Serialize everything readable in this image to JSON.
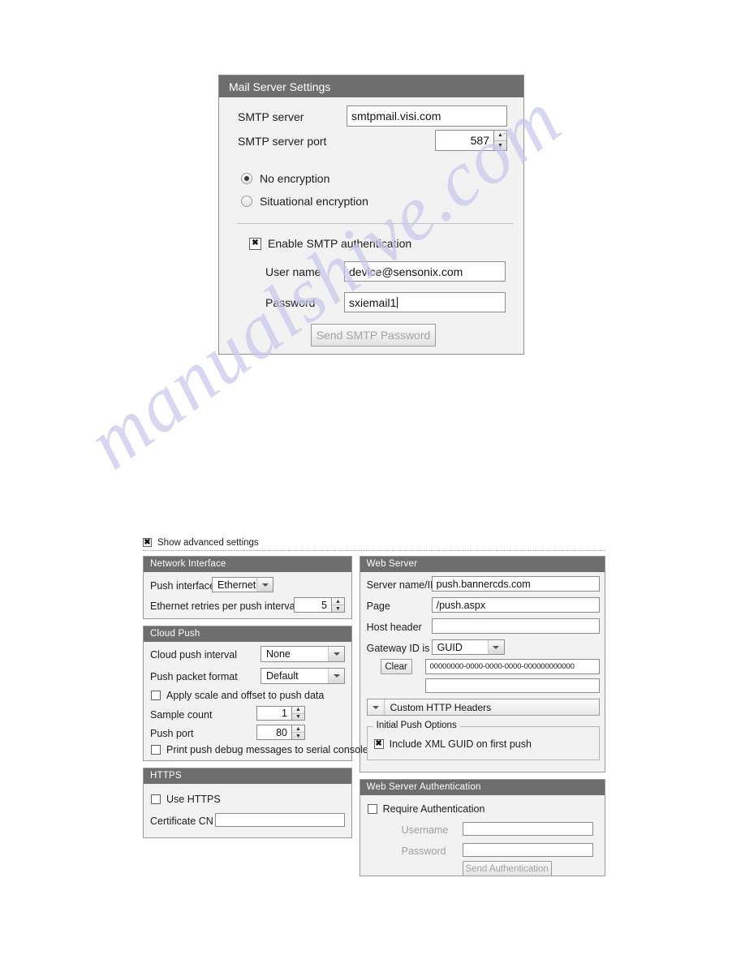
{
  "watermark": {
    "text": "manualshive.com"
  },
  "mail_dialog": {
    "title": "Mail Server Settings",
    "smtp_server_label": "SMTP server",
    "smtp_server_value": "smtpmail.visi.com",
    "smtp_port_label": "SMTP server port",
    "smtp_port_value": "587",
    "encryption_options": [
      {
        "label": "No encryption",
        "selected": true
      },
      {
        "label": "Situational encryption",
        "selected": false
      }
    ],
    "enable_auth_label": "Enable SMTP authentication",
    "enable_auth_checked": true,
    "username_label": "User name",
    "username_value": "device@sensonix.com",
    "password_label": "Password",
    "password_value": "sxiemail1",
    "send_button_label": "Send SMTP Password"
  },
  "advanced": {
    "show_advanced_label": "Show advanced settings",
    "show_advanced_checked": true,
    "network_interface": {
      "title": "Network Interface",
      "push_interface_label": "Push interface",
      "push_interface_value": "Ethernet",
      "retries_label": "Ethernet retries per push interval",
      "retries_value": "5"
    },
    "cloud_push": {
      "title": "Cloud Push",
      "interval_label": "Cloud push interval",
      "interval_value": "None",
      "packet_format_label": "Push packet format",
      "packet_format_value": "Default",
      "apply_scale_label": "Apply scale and offset to push data",
      "apply_scale_checked": false,
      "sample_count_label": "Sample count",
      "sample_count_value": "1",
      "push_port_label": "Push port",
      "push_port_value": "80",
      "debug_label": "Print push debug messages to serial console",
      "debug_checked": false
    },
    "https": {
      "title": "HTTPS",
      "use_https_label": "Use HTTPS",
      "use_https_checked": false,
      "cert_cn_label": "Certificate CN",
      "cert_cn_value": ""
    },
    "web_server": {
      "title": "Web Server",
      "server_name_label": "Server name/IP",
      "server_name_value": "push.bannercds.com",
      "page_label": "Page",
      "page_value": "/push.aspx",
      "host_header_label": "Host header",
      "host_header_value": "",
      "gateway_id_label": "Gateway ID is",
      "gateway_id_value": "GUID",
      "clear_button_label": "Clear",
      "guid_value": "00000000-0000-0000-0000-000000000000",
      "extra_field_value": "",
      "custom_headers_label": "Custom HTTP Headers",
      "initial_push_options_label": "Initial Push Options",
      "include_xml_guid_label": "Include XML GUID on first push",
      "include_xml_guid_checked": true
    },
    "web_server_auth": {
      "title": "Web Server Authentication",
      "require_auth_label": "Require Authentication",
      "require_auth_checked": false,
      "username_label": "Username",
      "username_value": "",
      "password_label": "Password",
      "password_value": "",
      "send_auth_button_label": "Send Authentication"
    }
  }
}
